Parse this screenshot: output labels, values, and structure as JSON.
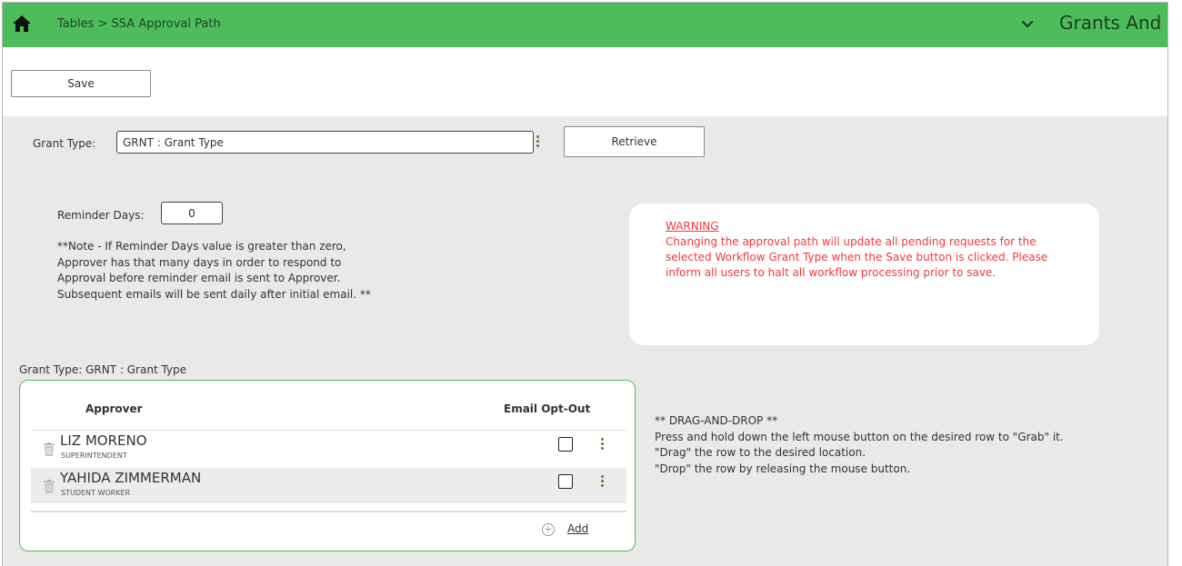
{
  "header": {
    "breadcrumb": "Tables > SSA Approval Path",
    "app_title": "Grants And",
    "background_color": "#4dbd5c"
  },
  "toolbar": {
    "save_label": "Save"
  },
  "filter": {
    "grant_type_label": "Grant Type:",
    "grant_type_value": "GRNT : Grant Type",
    "retrieve_label": "Retrieve"
  },
  "reminder": {
    "label": "Reminder Days:",
    "value": "0",
    "note_lines": [
      "**Note - If Reminder Days value is greater than zero,",
      "Approver has that many days in order to respond to",
      "Approval before reminder email is sent to Approver.",
      "Subsequent emails will be sent daily after initial email. **"
    ]
  },
  "warning": {
    "title": "WARNING",
    "body": "Changing the approval path will update all pending requests for the selected Workflow Grant Type when the Save button is clicked. Please inform all users to halt all workflow processing prior to save.",
    "color": "#f23a3a"
  },
  "grid": {
    "caption": "Grant Type: GRNT : Grant Type",
    "col_approver": "Approver",
    "col_email_opt_out": "Email Opt-Out",
    "rows": [
      {
        "name": "LIZ MORENO",
        "title": "SUPERINTENDENT",
        "email_opt_out": false
      },
      {
        "name": "YAHIDA ZIMMERMAN",
        "title": "STUDENT WORKER",
        "email_opt_out": false
      }
    ],
    "add_label": "Add",
    "border_color": "#4dbd5c"
  },
  "help": {
    "lines": [
      "** DRAG-AND-DROP **",
      "Press and hold down the left mouse button on the desired row to \"Grab\" it.",
      "\"Drag\" the row to the desired location.",
      "\"Drop\" the row by releasing the mouse button."
    ]
  },
  "icons": {
    "home": "home-icon",
    "chevron": "chevron-down-icon",
    "menu": "kebab-menu-icon",
    "delete": "trash-icon",
    "add": "add-circle-icon"
  }
}
